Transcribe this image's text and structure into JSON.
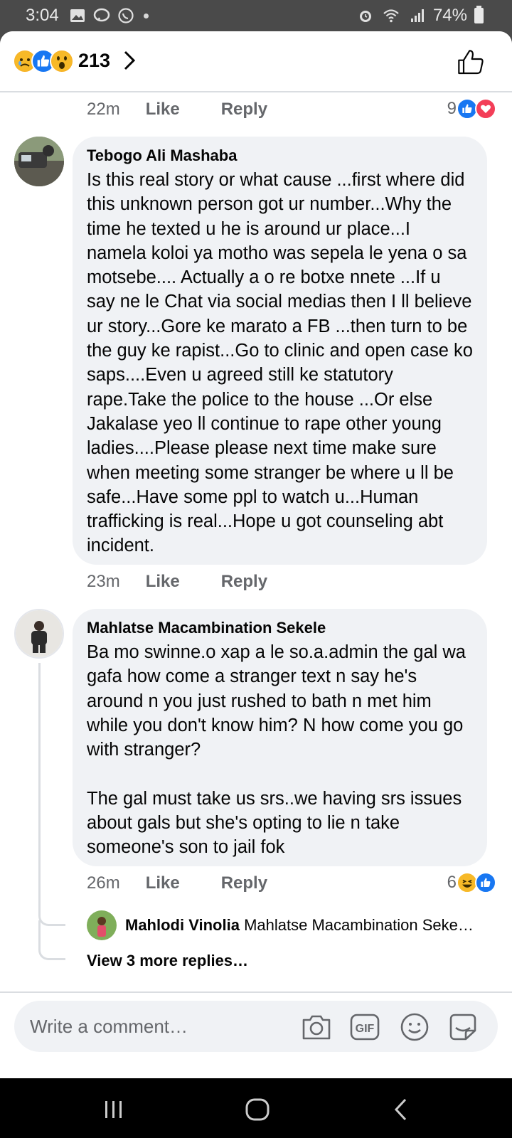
{
  "status_bar": {
    "time": "3:04",
    "battery": "74%"
  },
  "header": {
    "reaction_count": "213"
  },
  "comments": [
    {
      "time": "22m",
      "like": "Like",
      "reply": "Reply",
      "reaction_count": "9"
    },
    {
      "author": "Tebogo Ali Mashaba",
      "text": "Is this real story or what cause ...first where did this unknown person got ur number...Why the time he texted u he is around ur place...I namela koloi ya motho was sepela le yena o sa motsebe.... Actually a o re botxe nnete ...If u say ne le Chat via social medias then I ll believe ur story...Gore ke marato a FB ...then turn to be the guy ke rapist...Go to clinic and open case ko saps....Even u agreed still ke statutory rape.Take the police to the house ...Or else Jakalase yeo ll continue to rape other young ladies....Please please next time make sure when meeting some stranger be where u ll be safe...Have some ppl to watch u...Human trafficking is real...Hope u got counseling abt incident.",
      "time": "23m",
      "like": "Like",
      "reply": "Reply"
    },
    {
      "author": "Mahlatse Macambination Sekele",
      "text": "Ba mo swinne.o xap a le so.a.admin the gal wa gafa how come a stranger text n say he's around n you just rushed to bath n met him while you don't know him? N how come you go with stranger?\n\nThe gal must take us srs..we having srs issues about gals but she's opting to lie n take someone's son to jail fok",
      "time": "26m",
      "like": "Like",
      "reply": "Reply",
      "reaction_count": "6"
    }
  ],
  "reply_preview": {
    "author": "Mahlodi Vinolia",
    "snippet": "Mahlatse Macambination Seke…",
    "view_more": "View 3 more replies…"
  },
  "composer": {
    "placeholder": "Write a comment…"
  },
  "colors": {
    "facebook_blue": "#1877f2",
    "love_red": "#f33e58",
    "bubble_bg": "#f0f2f5",
    "meta_gray": "#65676b"
  },
  "icons": [
    "image-icon",
    "messenger-icon",
    "whatsapp-icon",
    "alarm-icon",
    "wifi-icon",
    "signal-icon",
    "battery-icon",
    "sad-emoji-icon",
    "like-emoji-icon",
    "wow-emoji-icon",
    "chevron-right-icon",
    "thumbs-up-outline-icon",
    "love-emoji-icon",
    "haha-emoji-icon",
    "camera-icon",
    "gif-icon",
    "smiley-icon",
    "sticker-icon",
    "recents-icon",
    "home-icon",
    "back-icon"
  ]
}
